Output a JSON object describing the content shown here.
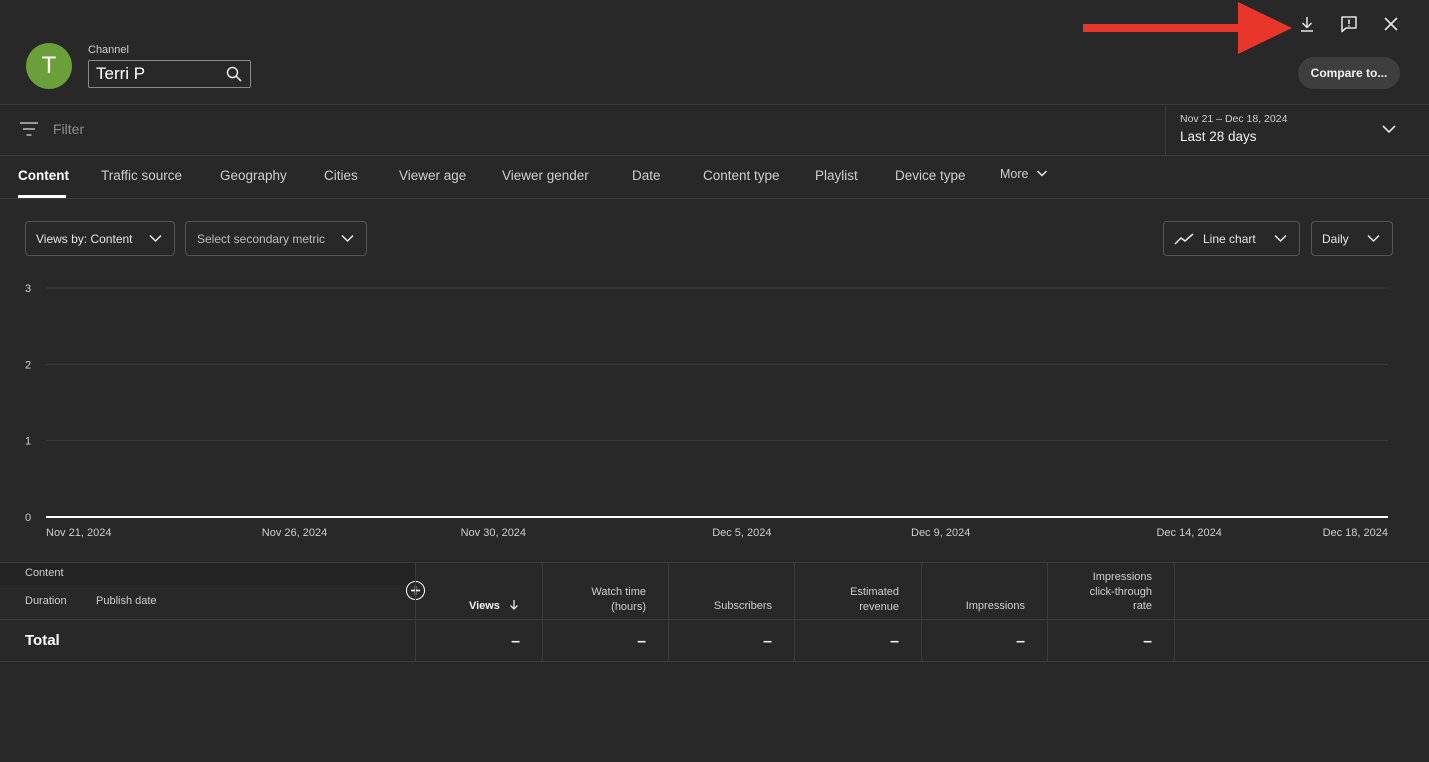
{
  "header": {
    "avatar_letter": "T",
    "channel_label": "Channel",
    "channel_value": "Terri P",
    "compare_label": "Compare to...",
    "top_icons": [
      "download-icon",
      "feedback-icon",
      "close-icon"
    ],
    "arrow_color": "#e8362b"
  },
  "filter": {
    "placeholder": "Filter",
    "date_range": "Nov 21 – Dec 18, 2024",
    "date_period": "Last 28 days"
  },
  "tabs": [
    {
      "label": "Content",
      "active": true
    },
    {
      "label": "Traffic source"
    },
    {
      "label": "Geography"
    },
    {
      "label": "Cities"
    },
    {
      "label": "Viewer age"
    },
    {
      "label": "Viewer gender"
    },
    {
      "label": "Date"
    },
    {
      "label": "Content type"
    },
    {
      "label": "Playlist"
    },
    {
      "label": "Device type"
    },
    {
      "label": "More"
    }
  ],
  "controls": {
    "primary_metric": "Views by: Content",
    "secondary_metric": "Select secondary metric",
    "chart_type": "Line chart",
    "granularity": "Daily"
  },
  "chart_data": {
    "type": "line",
    "x": [
      "Nov 21, 2024",
      "Nov 26, 2024",
      "Nov 30, 2024",
      "Dec 5, 2024",
      "Dec 9, 2024",
      "Dec 14, 2024",
      "Dec 18, 2024"
    ],
    "x_ticks": [
      "Nov 21, 2024",
      "Nov 26, 2024",
      "Nov 30, 2024",
      "Dec 5, 2024",
      "Dec 9, 2024",
      "Dec 14, 2024",
      "Dec 18, 2024"
    ],
    "y_ticks": [
      "0",
      "1",
      "2",
      "3"
    ],
    "ylim": [
      0,
      3
    ],
    "series": [
      {
        "values": [
          0,
          0,
          0,
          0,
          0,
          0,
          0
        ]
      }
    ],
    "grid": true
  },
  "table": {
    "header_left": {
      "content": "Content",
      "duration": "Duration",
      "publish_date": "Publish date"
    },
    "columns": [
      {
        "lines": [
          "Views"
        ],
        "sorted": true
      },
      {
        "lines": [
          "Watch time",
          "(hours)"
        ]
      },
      {
        "lines": [
          "Subscribers"
        ]
      },
      {
        "lines": [
          "Estimated",
          "revenue"
        ]
      },
      {
        "lines": [
          "Impressions"
        ]
      },
      {
        "lines": [
          "Impressions",
          "click-through",
          "rate"
        ]
      }
    ],
    "total_label": "Total",
    "total_values": [
      "–",
      "–",
      "–",
      "–",
      "–",
      "–"
    ]
  }
}
